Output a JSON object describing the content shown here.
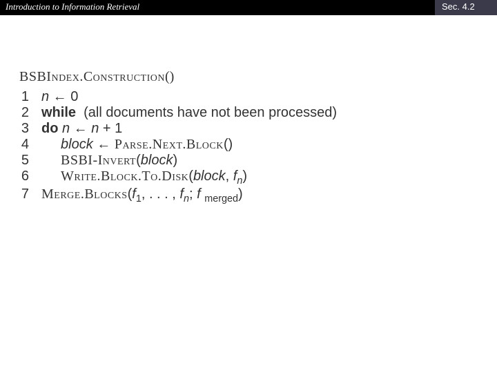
{
  "header": {
    "title": "Introduction to Information Retrieval",
    "section": "Sec. 4.2"
  },
  "algo": {
    "title_sc": "BSBIndex.Construction",
    "title_paren": "()",
    "lines": [
      {
        "n": "1",
        "html": "<span class='it'>n</span> ← 0"
      },
      {
        "n": "2",
        "html": "<span class='kw'>while</span>&nbsp;&nbsp;(all documents have not been processed)"
      },
      {
        "n": "3",
        "html": "<span class='kw'>do</span> <span class='it'>n</span> ← <span class='it'>n</span> + 1"
      },
      {
        "n": "4",
        "html": "<span class='ind2'></span><span class='it'>block</span> ← <span class='rm sc'>Parse.Next.Block</span>()"
      },
      {
        "n": "5",
        "html": "<span class='ind2'></span><span class='rm sc'>BSBI-Invert</span>(<span class='it'>block</span>)"
      },
      {
        "n": "6",
        "html": "<span class='ind2'></span><span class='rm sc'>Write.Block.To.Disk</span>(<span class='it'>block</span>, <span class='it'>f</span><span class='sub'>n</span>)"
      },
      {
        "n": "7",
        "html": "<span class='rm sc'>Merge.Blocks</span>(<span class='it'>f</span><span class='subt'>1</span>, . . . , <span class='it'>f</span><span class='sub'>n</span>; <span class='it'>f</span> <span class='subt'>merged</span>)"
      }
    ]
  }
}
